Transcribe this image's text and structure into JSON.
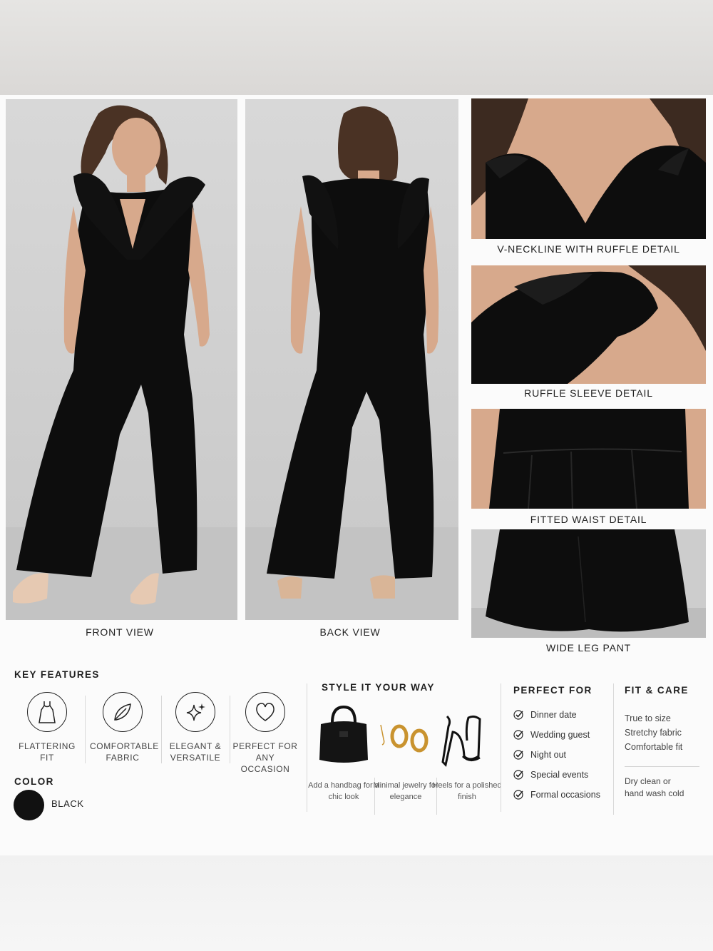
{
  "views": {
    "front_label": "FRONT VIEW",
    "back_label": "BACK VIEW"
  },
  "details": [
    {
      "label": "V-NECKLINE WITH RUFFLE DETAIL"
    },
    {
      "label": "RUFFLE SLEEVE DETAIL"
    },
    {
      "label": "FITTED WAIST DETAIL"
    },
    {
      "label": "WIDE LEG PANT"
    }
  ],
  "key_features": {
    "title": "KEY FEATURES",
    "items": [
      {
        "label": "FLATTERING FIT",
        "icon": "dress-icon"
      },
      {
        "label": "COMFORTABLE FABRIC",
        "icon": "leaf-icon"
      },
      {
        "label": "ELEGANT & VERSATILE",
        "icon": "sparkle-icon"
      },
      {
        "label": "PERFECT FOR ANY OCCASION",
        "icon": "heart-icon"
      }
    ]
  },
  "color": {
    "title": "COLOR",
    "name": "BLACK",
    "swatch": "#111111"
  },
  "style_it": {
    "title": "STYLE IT YOUR WAY",
    "items": [
      {
        "label": "Add a handbag for a chic look",
        "icon": "handbag-icon"
      },
      {
        "label": "Minimal jewelry for elegance",
        "icon": "hoop-earrings-icon"
      },
      {
        "label": "Heels for a polished finish",
        "icon": "heels-icon"
      }
    ]
  },
  "perfect_for": {
    "title": "PERFECT FOR",
    "items": [
      "Dinner date",
      "Wedding guest",
      "Night out",
      "Special events",
      "Formal occasions"
    ]
  },
  "fit_care": {
    "title": "FIT & CARE",
    "fit": [
      "True to size",
      "Stretchy fabric",
      "Comfortable fit"
    ],
    "care": [
      "Dry clean or",
      "hand wash cold"
    ]
  },
  "colors": {
    "garment": "#0d0d0d",
    "skin": "#d7a98c",
    "hair": "#4a3224",
    "accent_gold": "#c9932f"
  }
}
